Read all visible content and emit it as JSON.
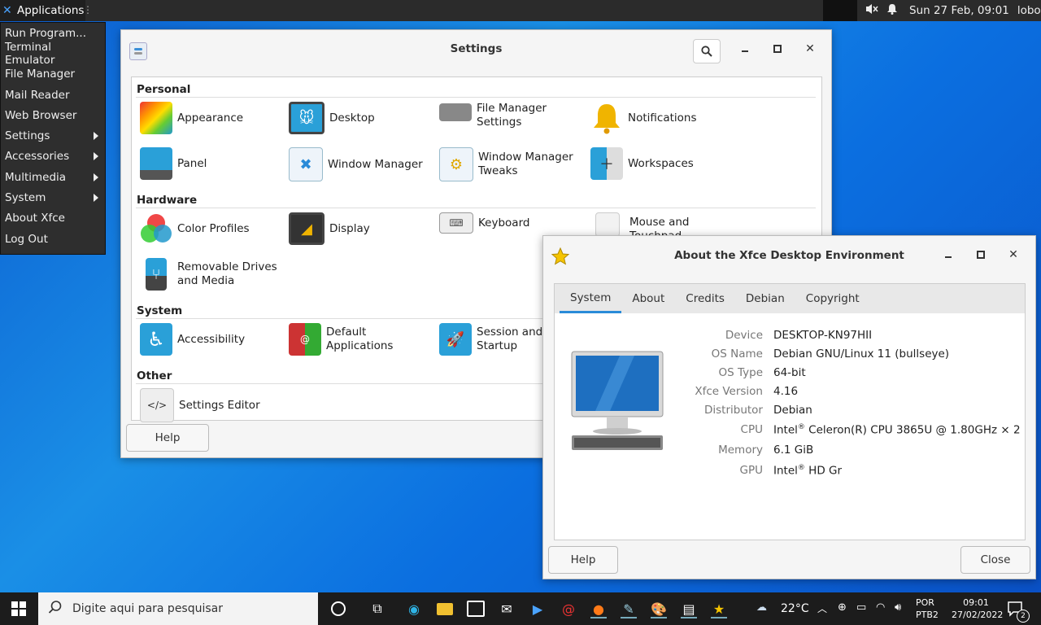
{
  "top_panel": {
    "apps_label": "Applications",
    "clock": "Sun 27 Feb, 09:01",
    "user": "lobo"
  },
  "app_menu": {
    "items": [
      {
        "label": "Run Program...",
        "submenu": false
      },
      {
        "label": "Terminal Emulator",
        "submenu": false
      },
      {
        "label": "File Manager",
        "submenu": false
      },
      {
        "label": "Mail Reader",
        "submenu": false
      },
      {
        "label": "Web Browser",
        "submenu": false
      },
      {
        "label": "Settings",
        "submenu": true
      },
      {
        "label": "Accessories",
        "submenu": true
      },
      {
        "label": "Multimedia",
        "submenu": true
      },
      {
        "label": "System",
        "submenu": true
      },
      {
        "label": "About Xfce",
        "submenu": false
      },
      {
        "label": "Log Out",
        "submenu": false
      }
    ]
  },
  "settings": {
    "title": "Settings",
    "sections": {
      "personal": "Personal",
      "hardware": "Hardware",
      "system": "System",
      "other": "Other"
    },
    "items": {
      "appearance": "Appearance",
      "desktop": "Desktop",
      "file_manager_1": "File Manager",
      "file_manager_2": "Settings",
      "notifications": "Notifications",
      "panel": "Panel",
      "window_manager": "Window Manager",
      "wm_tweaks_1": "Window Manager",
      "wm_tweaks_2": "Tweaks",
      "workspaces": "Workspaces",
      "color_profiles": "Color Profiles",
      "display": "Display",
      "keyboard": "Keyboard",
      "mouse_1": "Mouse and",
      "mouse_2": "Touchpad",
      "removable_1": "Removable Drives",
      "removable_2": "and Media",
      "accessibility": "Accessibility",
      "default_apps_1": "Default",
      "default_apps_2": "Applications",
      "session_1": "Session and",
      "session_2": "Startup",
      "settings_editor": "Settings Editor"
    },
    "help_label": "Help"
  },
  "about": {
    "title": "About the Xfce Desktop Environment",
    "tabs": [
      "System",
      "About",
      "Credits",
      "Debian",
      "Copyright"
    ],
    "labels": {
      "device": "Device",
      "os_name": "OS Name",
      "os_type": "OS Type",
      "xfce_version": "Xfce Version",
      "distributor": "Distributor",
      "cpu": "CPU",
      "memory": "Memory",
      "gpu": "GPU"
    },
    "values": {
      "device": "DESKTOP-KN97HII",
      "os_name": "Debian GNU/Linux 11 (bullseye)",
      "os_type": "64-bit",
      "xfce_version": "4.16",
      "distributor": "Debian",
      "cpu_prefix": "Intel",
      "cpu_rest": " Celeron(R) CPU 3865U @ 1.80GHz × 2",
      "memory": "6.1 GiB",
      "gpu_prefix": "Intel",
      "gpu_rest": " HD Gr",
      "reg": "®"
    },
    "help_label": "Help",
    "close_label": "Close"
  },
  "taskbar": {
    "search_placeholder": "Digite aqui para pesquisar",
    "weather": "22°C",
    "lang_1": "POR",
    "lang_2": "PTB2",
    "time": "09:01",
    "date": "27/02/2022",
    "notif_count": "2"
  }
}
